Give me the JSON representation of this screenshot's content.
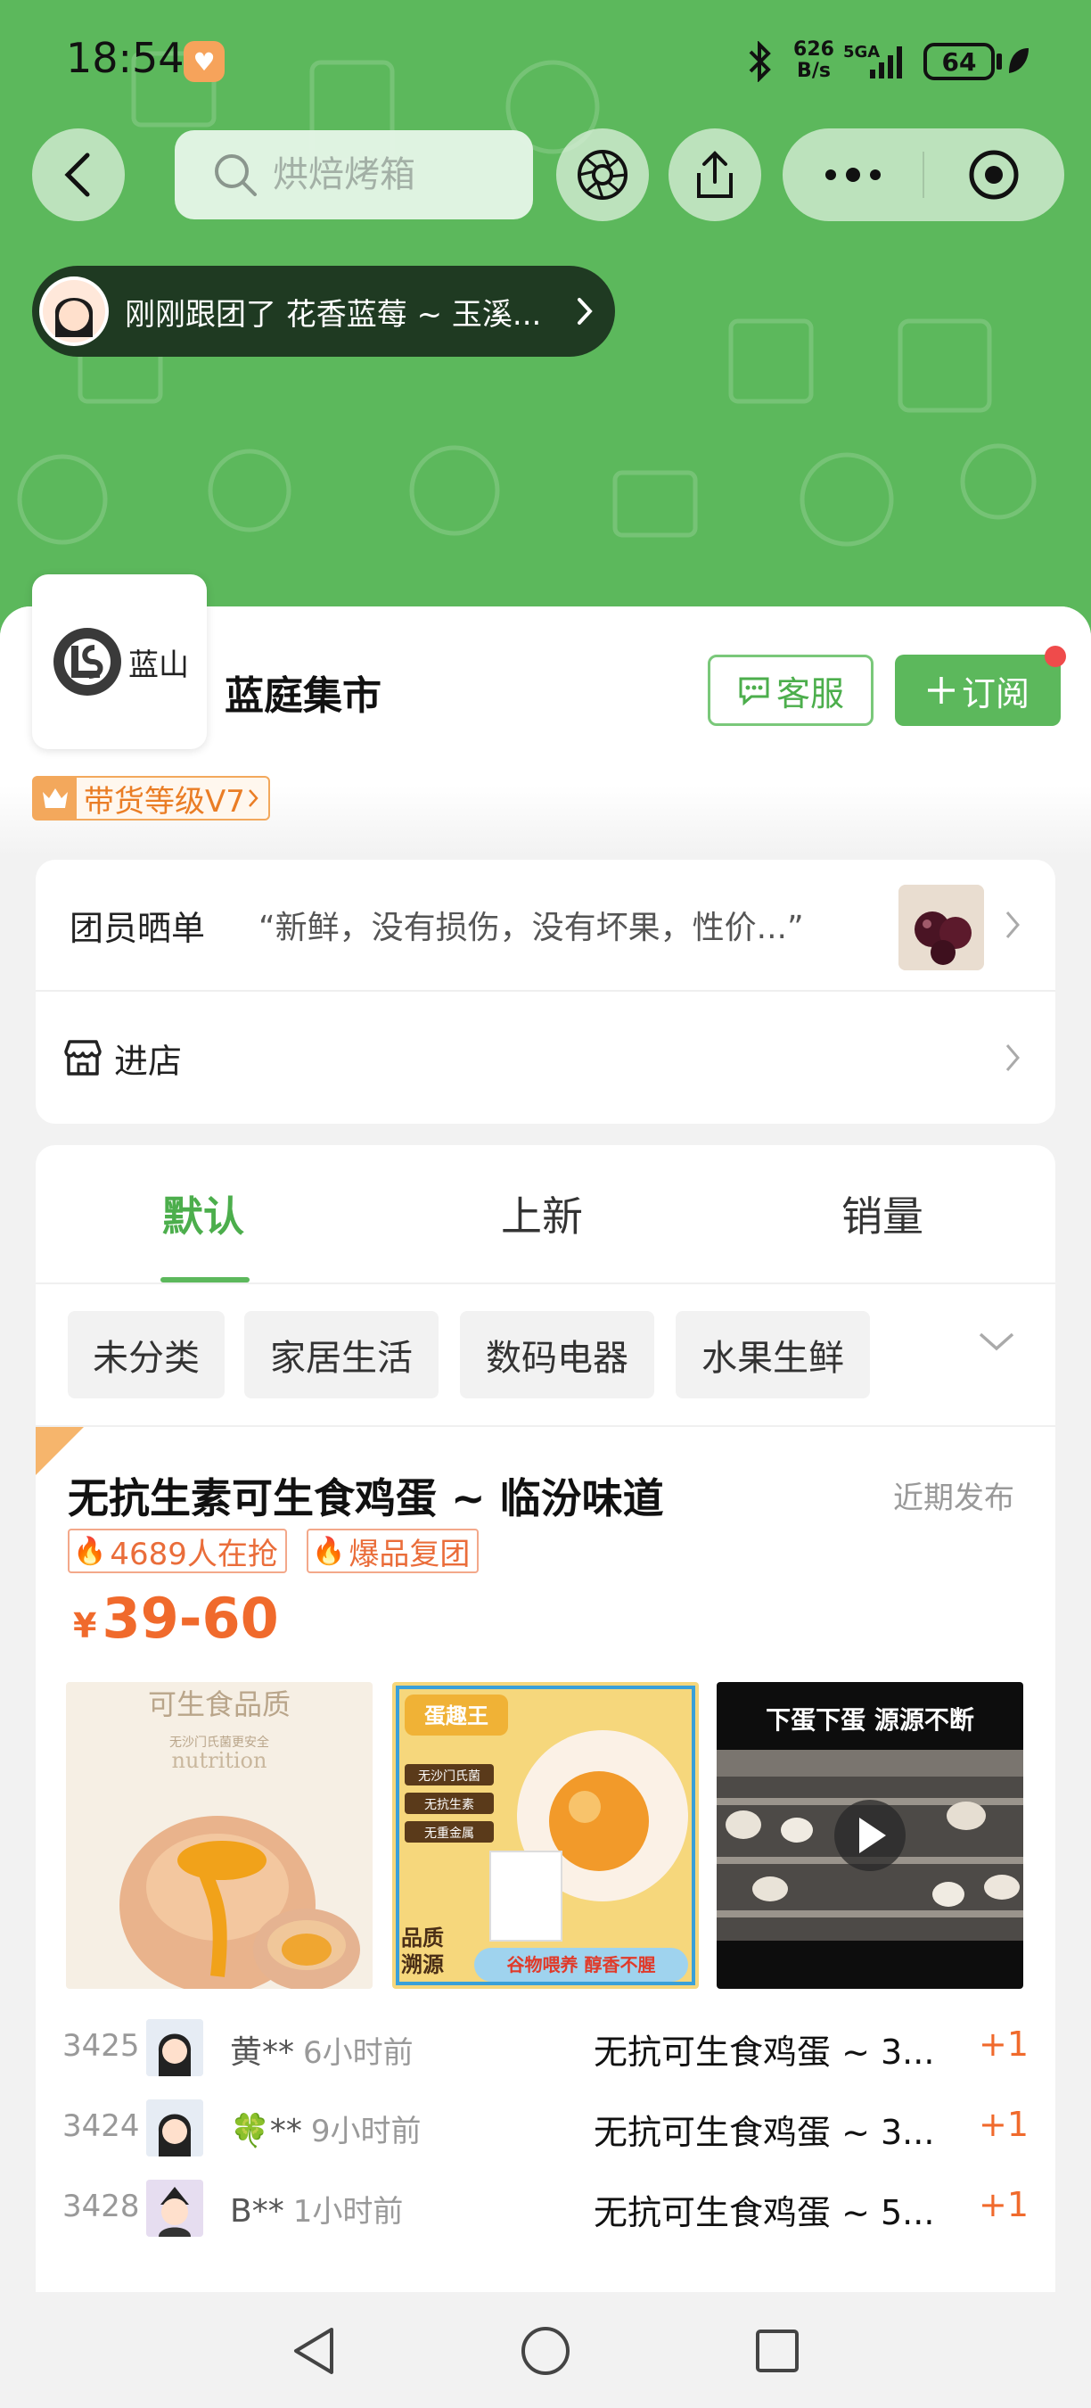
{
  "status_bar": {
    "time": "18:54",
    "net_speed_value": "626",
    "net_speed_unit": "B/s",
    "network": "5GA",
    "battery": "64"
  },
  "nav": {
    "search_placeholder": "烘焙烤箱"
  },
  "follow_banner": {
    "text": "刚刚跟团了 花香蓝莓 ~ 玉溪..."
  },
  "shop": {
    "logo_text": "蓝山",
    "name": "蓝庭集市",
    "service_label": "客服",
    "subscribe_label": "订阅",
    "level_label": "带货等级V7"
  },
  "info": {
    "review_label": "团员晒单",
    "review_quote": "“新鲜，没有损伤，没有坏果，性价...”",
    "store_label": "进店"
  },
  "tabs": [
    {
      "label": "默认",
      "active": true
    },
    {
      "label": "上新",
      "active": false
    },
    {
      "label": "销量",
      "active": false
    }
  ],
  "categories": [
    "未分类",
    "家居生活",
    "数码电器",
    "水果生鲜"
  ],
  "product": {
    "title": "无抗生素可生食鸡蛋 ~ 临汾味道",
    "published": "近期发布",
    "tags": [
      "4689人在抢",
      "爆品复团"
    ],
    "price_symbol": "¥",
    "price": "39-60",
    "images": [
      {
        "heading": "可生食品质",
        "sub": "无沙门氏菌更安全",
        "word": "nutrition"
      },
      {
        "brand": "蛋趣王",
        "badges": [
          "无沙门氏菌",
          "无抗生素",
          "无重金属"
        ],
        "side_text": "品质溯源",
        "footer": "谷物喂养 醇香不腥"
      },
      {
        "caption": "下蛋下蛋 源源不断"
      }
    ]
  },
  "buyers": [
    {
      "no": "3425",
      "name": "黄**",
      "when": "6小时前",
      "item": "无抗可生食鸡蛋 ~ 3...",
      "qty": "+1"
    },
    {
      "no": "3424",
      "name": "🍀**",
      "when": "9小时前",
      "item": "无抗可生食鸡蛋 ~ 3...",
      "qty": "+1"
    },
    {
      "no": "3428",
      "name": "B**",
      "when": "1小时前",
      "item": "无抗可生食鸡蛋 ~ 5...",
      "qty": "+1"
    }
  ],
  "colors": {
    "brand_green": "#5cb85c",
    "accent_orange": "#f06a2c"
  }
}
